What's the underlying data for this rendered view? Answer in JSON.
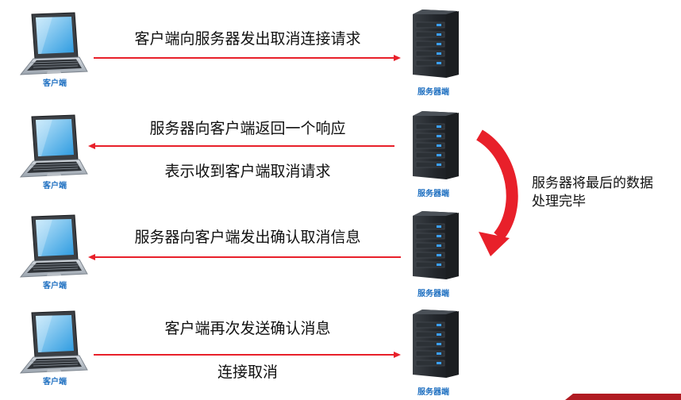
{
  "labels": {
    "client": "客户端",
    "server": "服务器端"
  },
  "steps": [
    {
      "direction": "to-server",
      "lines": [
        "客户端向服务器发出取消连接请求"
      ]
    },
    {
      "direction": "to-client",
      "lines": [
        "服务器向客户端返回一个响应",
        "表示收到客户端取消请求"
      ]
    },
    {
      "direction": "to-client",
      "lines": [
        "服务器向客户端发出确认取消信息"
      ]
    },
    {
      "direction": "to-server",
      "lines": [
        "客户端再次发送确认消息",
        "连接取消"
      ]
    }
  ],
  "note": {
    "lines": [
      "服务器将最后的数据",
      "处理完毕"
    ]
  },
  "colors": {
    "arrow": "#e8202a",
    "label": "#1f70c1",
    "text": "#111111"
  }
}
